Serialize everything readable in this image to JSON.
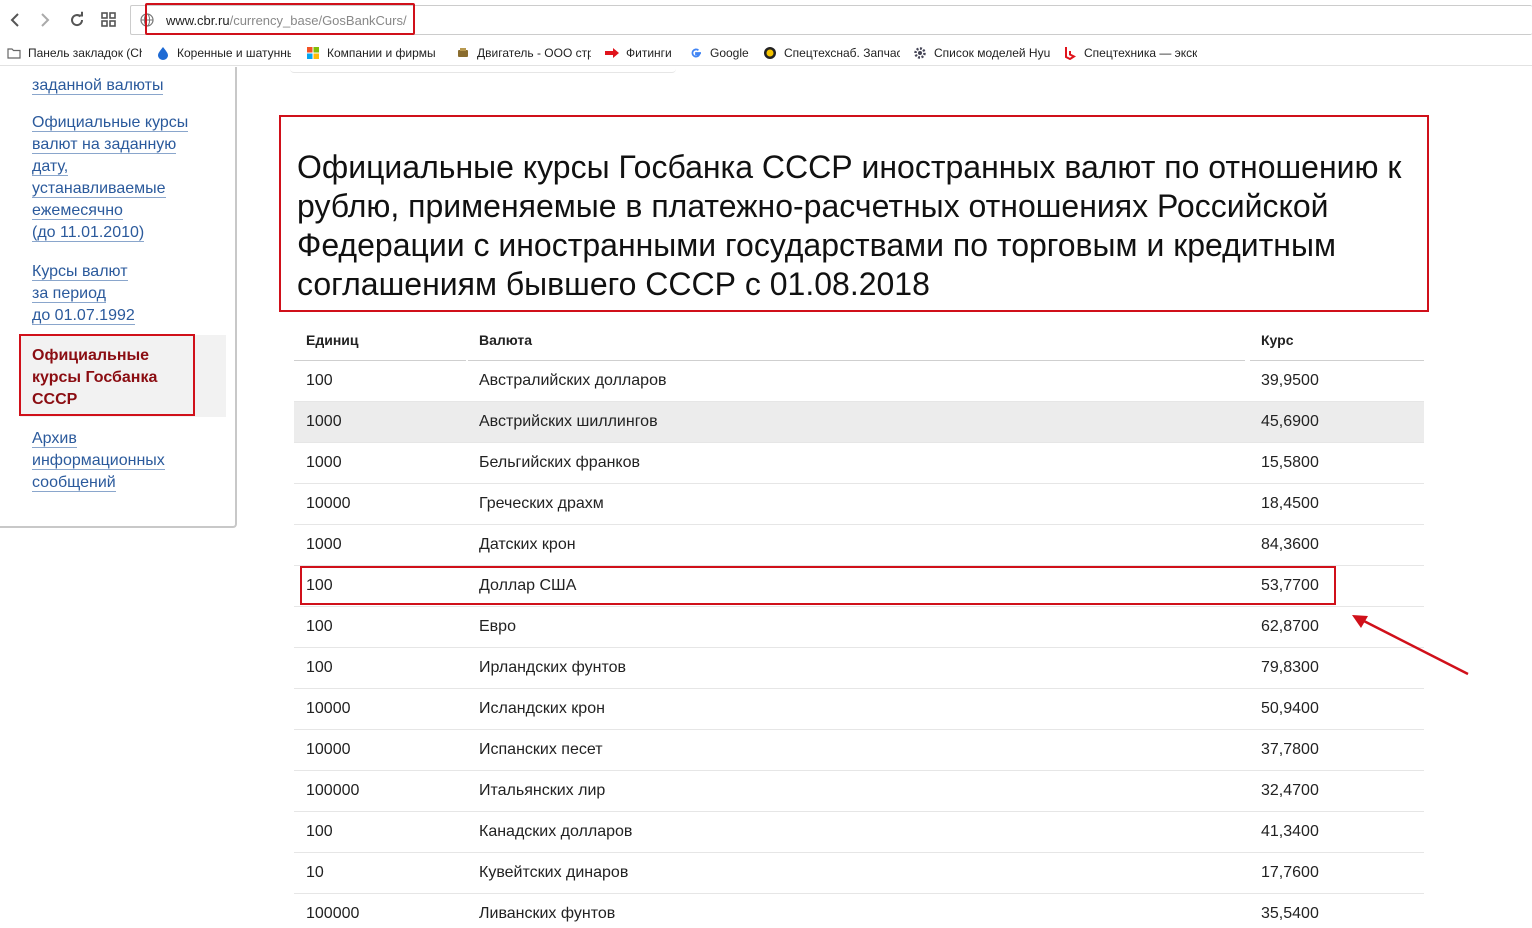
{
  "browser": {
    "address_host": "www.cbr.ru",
    "address_path": "/currency_base/GosBankCurs/",
    "bookmarks": [
      {
        "label": "Панель закладок (Сh",
        "icon": "folder-icon"
      },
      {
        "label": "Коренные и шатунные",
        "icon": "water-drop-icon"
      },
      {
        "label": "Компании и фирмы",
        "icon": "tiles-icon"
      },
      {
        "label": "Двигатель - ООО стр",
        "icon": "engine-icon"
      },
      {
        "label": "Фитинги",
        "icon": "red-arrow-icon"
      },
      {
        "label": "Google",
        "icon": "google-icon"
      },
      {
        "label": "Спецтехснаб. Запчас",
        "icon": "sun-icon"
      },
      {
        "label": "Список моделей Hyu",
        "icon": "gear-icon"
      },
      {
        "label": "Спецтехника — экск",
        "icon": "bing-icon"
      }
    ]
  },
  "sidebar": {
    "links": [
      {
        "label": "заданной валюты"
      },
      {
        "lines": [
          "Официальные курсы",
          "валют на заданную",
          "дату,",
          "устанавливаемые",
          "ежемесячно",
          "(до 11.01.2010)"
        ]
      },
      {
        "lines": [
          "Курсы валют",
          "за период",
          "до 01.07.1992"
        ]
      },
      {
        "lines": [
          "Архив",
          "информационных",
          "сообщений"
        ]
      }
    ],
    "active_lines": [
      "Официальные",
      "курсы Госбанка",
      "СССР"
    ]
  },
  "page": {
    "heading": "Официальные курсы Госбанка СССР иностранных валют по отношению к рублю, применяемые в платежно-расчетных отношениях Российской Федерации с иностранными государствами по торговым и кредитным соглашениям бывшего СССР с 01.08.2018"
  },
  "table": {
    "headers": [
      "Единиц",
      "Валюта",
      "Курс"
    ],
    "rows": [
      [
        "100",
        "Австралийских долларов",
        "39,9500"
      ],
      [
        "1000",
        "Австрийских шиллингов",
        "45,6900"
      ],
      [
        "1000",
        "Бельгийских франков",
        "15,5800"
      ],
      [
        "10000",
        "Греческих драхм",
        "18,4500"
      ],
      [
        "1000",
        "Датских крон",
        "84,3600"
      ],
      [
        "100",
        "Доллар США",
        "53,7700"
      ],
      [
        "100",
        "Евро",
        "62,8700"
      ],
      [
        "100",
        "Ирландских фунтов",
        "79,8300"
      ],
      [
        "10000",
        "Исландских крон",
        "50,9400"
      ],
      [
        "10000",
        "Испанских песет",
        "37,7800"
      ],
      [
        "100000",
        "Итальянских лир",
        "32,4700"
      ],
      [
        "100",
        "Канадских долларов",
        "41,3400"
      ],
      [
        "10",
        "Кувейтских динаров",
        "17,7600"
      ],
      [
        "100000",
        "Ливанских фунтов",
        "35,5400"
      ]
    ]
  },
  "colors": {
    "highlight": "#d0101a",
    "link": "#2b5a9c",
    "active": "#8b0d12"
  }
}
